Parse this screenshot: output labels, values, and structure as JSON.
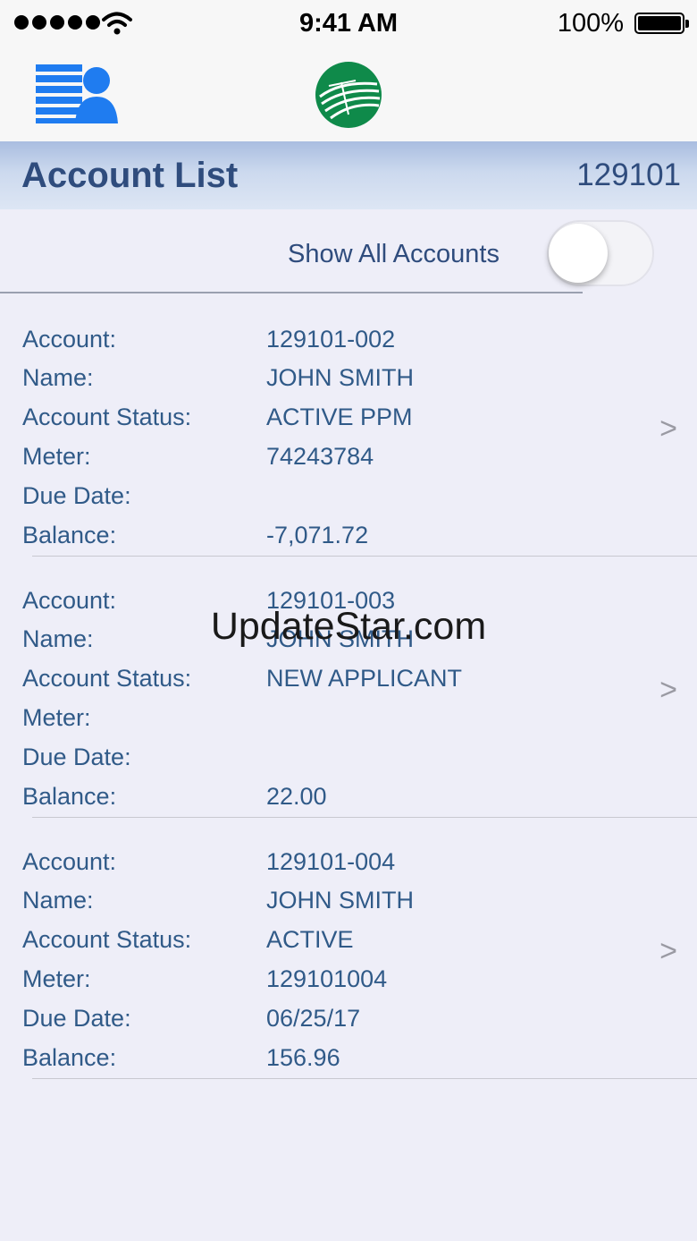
{
  "status_bar": {
    "time": "9:41 AM",
    "battery": "100%"
  },
  "header": {
    "title": "Account List",
    "member_number": "129101"
  },
  "toggle": {
    "label": "Show All Accounts",
    "on": false
  },
  "labels": {
    "account": "Account:",
    "name": "Name:",
    "status": "Account Status:",
    "meter": "Meter:",
    "due_date": "Due Date:",
    "balance": "Balance:"
  },
  "accounts": [
    {
      "account": "129101-002",
      "name": "JOHN SMITH",
      "status": "ACTIVE PPM",
      "meter": "74243784",
      "due_date": "",
      "balance": "-7,071.72"
    },
    {
      "account": "129101-003",
      "name": "JOHN SMITH",
      "status": "NEW APPLICANT",
      "meter": "",
      "due_date": "",
      "balance": "22.00"
    },
    {
      "account": "129101-004",
      "name": "JOHN SMITH",
      "status": "ACTIVE",
      "meter": "129101004",
      "due_date": "06/25/17",
      "balance": "156.96"
    }
  ],
  "chevron": ">",
  "watermark": "UpdateStar.com",
  "colors": {
    "brand_blue": "#1f7cf0",
    "logo_green": "#0f8a4a",
    "text_blue": "#305a88",
    "title_blue": "#2f4c7d"
  }
}
